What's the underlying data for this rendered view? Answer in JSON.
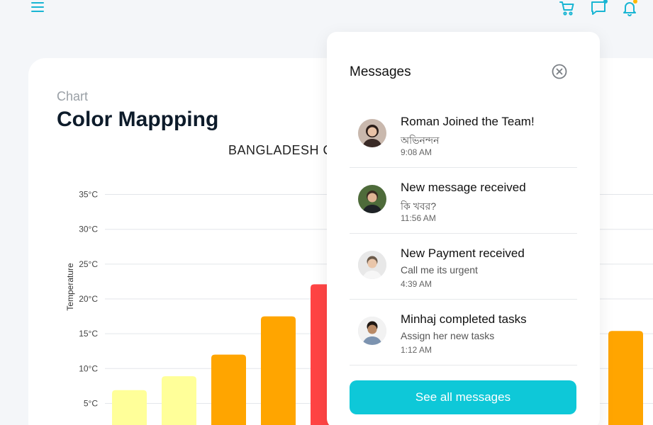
{
  "topbar": {
    "menu_icon": "hamburger-menu-icon",
    "cart_icon": "cart-icon",
    "chat_icon": "chat-bubble-icon",
    "bell_icon": "bell-icon",
    "accent": "#19b5d3",
    "dot_color": "#ffb800"
  },
  "card": {
    "subtitle": "Chart",
    "title": "Color Mappping"
  },
  "chart_data": {
    "type": "bar",
    "title": "BANGLADESH C",
    "ylabel": "Temperature",
    "ylim": [
      0,
      35
    ],
    "yticks": [
      "35°C",
      "30°C",
      "25°C",
      "20°C",
      "15°C",
      "10°C",
      "5°C"
    ],
    "ytick_values": [
      35,
      30,
      25,
      20,
      15,
      10,
      5
    ],
    "values": [
      6.9,
      8.9,
      12.0,
      17.5,
      22.1,
      15.4
    ],
    "colors": [
      "#ffff99",
      "#ffff99",
      "#ffa500",
      "#ffa500",
      "#ff4444",
      "#ffa500"
    ],
    "grid": true
  },
  "messages_panel": {
    "title": "Messages",
    "close_icon": "close-circle-icon",
    "items": [
      {
        "title": "Roman Joined the Team!",
        "text": "অভিনন্দন",
        "time": "9:08 AM",
        "avatar": "female-avatar"
      },
      {
        "title": "New message received",
        "text": "কি খবর?",
        "time": "11:56 AM",
        "avatar": "male-avatar"
      },
      {
        "title": "New Payment received",
        "text": "Call me its urgent",
        "time": "4:39 AM",
        "avatar": "male-avatar"
      },
      {
        "title": "Minhaj completed tasks",
        "text": "Assign her new tasks",
        "time": "1:12 AM",
        "avatar": "male-avatar"
      }
    ],
    "see_all_label": "See all messages"
  }
}
